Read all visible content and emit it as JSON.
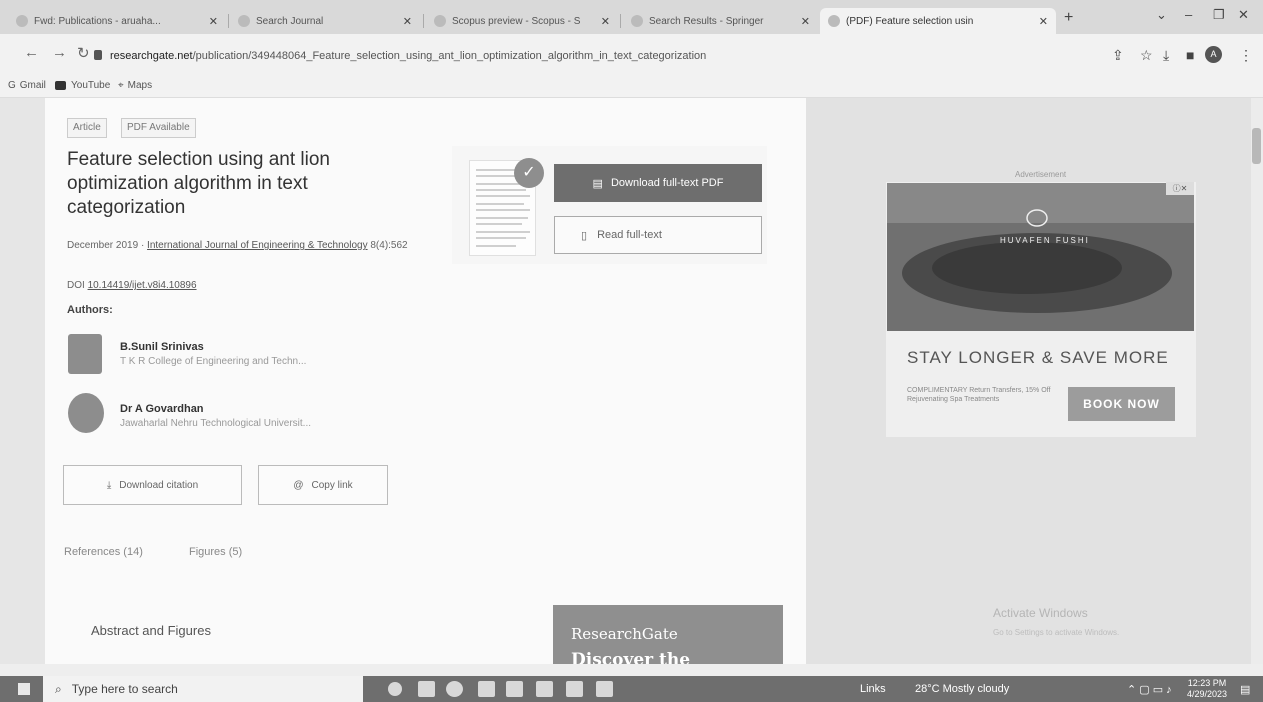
{
  "browser": {
    "tabs": [
      {
        "title": "Fwd: Publications - aruaha...",
        "active": false
      },
      {
        "title": "Search Journal",
        "active": false
      },
      {
        "title": "Scopus preview - Scopus - S",
        "active": false
      },
      {
        "title": "Search Results - Springer",
        "active": false
      },
      {
        "title": "(PDF) Feature selection usin",
        "active": true
      }
    ],
    "new_tab": "+",
    "url_host": "researchgate.net",
    "url_path": "/publication/349448064_Feature_selection_using_ant_lion_optimization_algorithm_in_text_categorization",
    "bookmarks": [
      {
        "label": "Gmail",
        "icon": "gmail-icon"
      },
      {
        "label": "YouTube",
        "icon": "youtube-icon"
      },
      {
        "label": "Maps",
        "icon": "maps-icon"
      }
    ],
    "profile_initial": "A"
  },
  "article": {
    "badges": [
      "Article",
      "PDF Available"
    ],
    "title": "Feature selection using ant lion optimization algorithm in text categorization",
    "date": "December 2019",
    "journal": "International Journal of Engineering & Technology",
    "volume": "8(4):562",
    "doi_label": "DOI",
    "doi": "10.14419/ijet.v8i4.10896",
    "authors_heading": "Authors:",
    "authors": [
      {
        "name": "B.Sunil Srinivas",
        "affiliation": "T K R College of Engineering and Techn..."
      },
      {
        "name": "Dr A Govardhan",
        "affiliation": "Jawaharlal Nehru Technological Universit..."
      }
    ],
    "download_citation": "Download citation",
    "copy_link": "Copy link",
    "references_tab": "References (14)",
    "figures_tab": "Figures (5)",
    "abstract_heading": "Abstract and Figures",
    "download_pdf": "Download full-text PDF",
    "read_full": "Read full-text"
  },
  "promo": {
    "line1": "ResearchGate",
    "line2": "Discover the"
  },
  "ad": {
    "label": "Advertisement",
    "brand": "HUVAFEN FUSHI",
    "headline": "STAY LONGER & SAVE MORE",
    "sub": "COMPLIMENTARY Return Transfers, 15% Off Rejuvenating Spa Treatments",
    "cta": "BOOK NOW"
  },
  "watermark": {
    "title": "Activate Windows",
    "subtitle": "Go to Settings to activate Windows."
  },
  "taskbar": {
    "search_placeholder": "Type here to search",
    "links": "Links",
    "weather": "28°C Mostly cloudy",
    "time": "12:23 PM",
    "date": "4/29/2023"
  }
}
